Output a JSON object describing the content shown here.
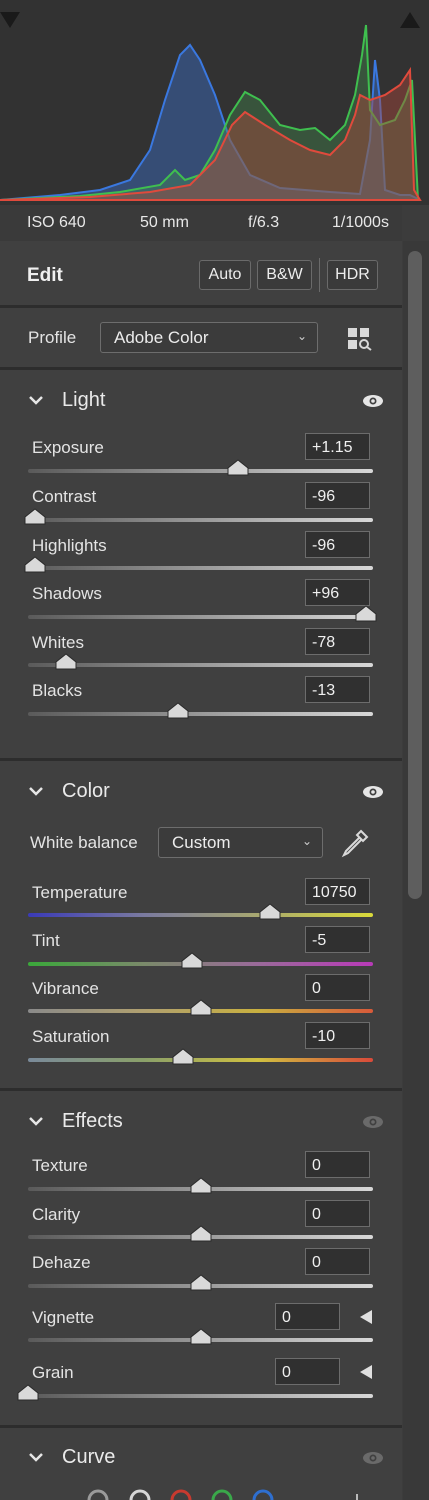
{
  "camera": {
    "iso": "ISO 640",
    "focal": "50 mm",
    "aperture": "f/6.3",
    "shutter": "1/1000s"
  },
  "edit": {
    "title": "Edit",
    "auto": "Auto",
    "bw": "B&W",
    "hdr": "HDR"
  },
  "profile": {
    "label": "Profile",
    "value": "Adobe Color",
    "browse_icon": "profile-browser-icon"
  },
  "light": {
    "title": "Light",
    "sliders": [
      {
        "label": "Exposure",
        "value": "+1.15",
        "position": 0.61
      },
      {
        "label": "Contrast",
        "value": "-96",
        "position": 0.02
      },
      {
        "label": "Highlights",
        "value": "-96",
        "position": 0.02
      },
      {
        "label": "Shadows",
        "value": "+96",
        "position": 0.98
      },
      {
        "label": "Whites",
        "value": "-78",
        "position": 0.11
      },
      {
        "label": "Blacks",
        "value": "-13",
        "position": 0.435
      }
    ]
  },
  "color": {
    "title": "Color",
    "wb_label": "White balance",
    "wb_value": "Custom",
    "sliders": [
      {
        "label": "Temperature",
        "value": "10750",
        "position": 0.7
      },
      {
        "label": "Tint",
        "value": "-5",
        "position": 0.475
      },
      {
        "label": "Vibrance",
        "value": "0",
        "position": 0.5
      },
      {
        "label": "Saturation",
        "value": "-10",
        "position": 0.45
      }
    ]
  },
  "effects": {
    "title": "Effects",
    "sliders": [
      {
        "label": "Texture",
        "value": "0",
        "position": 0.5
      },
      {
        "label": "Clarity",
        "value": "0",
        "position": 0.5
      },
      {
        "label": "Dehaze",
        "value": "0",
        "position": 0.5
      },
      {
        "label": "Vignette",
        "value": "0",
        "position": 0.5
      },
      {
        "label": "Grain",
        "value": "0",
        "position": 0.0
      }
    ]
  },
  "curve": {
    "title": "Curve"
  },
  "colors": {
    "panel": "#404040",
    "histogram_bg": "#323232",
    "accent_red": "#e04a3c",
    "accent_green": "#3fbf4f",
    "accent_blue": "#2f7fe6"
  }
}
